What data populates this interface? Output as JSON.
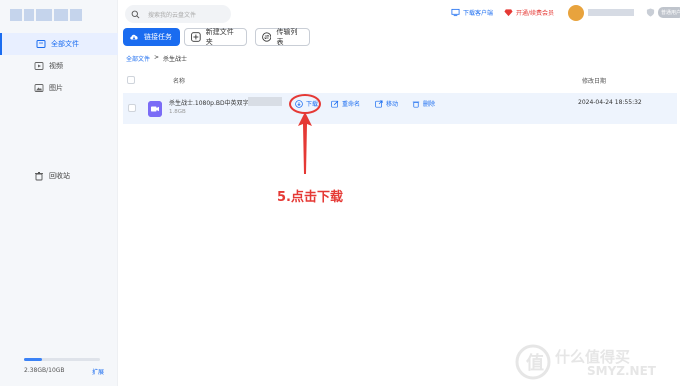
{
  "sidebar": {
    "items": [
      {
        "label": "全部文件",
        "icon": "folder-icon",
        "active": true
      },
      {
        "label": "视频",
        "icon": "video-icon"
      },
      {
        "label": "图片",
        "icon": "image-icon"
      },
      {
        "label": "回收站",
        "icon": "trash-icon"
      }
    ],
    "storage": {
      "text": "2.38GB/10GB",
      "expand": "扩展",
      "used_fraction": 0.238
    }
  },
  "header": {
    "search_placeholder": "搜索我的云盘文件",
    "client_link": "下载客户端",
    "vip_link": "开通/续费会员",
    "vip_badge": "普通用户"
  },
  "toolbar": {
    "link_task": "链接任务",
    "new_folder": "新建文件夹",
    "transfer_list": "传输列表"
  },
  "breadcrumb": {
    "root": "全部文件",
    "sep": ">",
    "current": "杀生战士"
  },
  "table": {
    "col_name": "名称",
    "col_date": "修改日期",
    "rows": [
      {
        "name": "杀生战士.1080p.BD中英双字",
        "size": "1.8GB",
        "date": "2024-04-24 18:55:32",
        "actions": [
          "下载",
          "重命名",
          "移动",
          "删除"
        ]
      }
    ]
  },
  "annotation": {
    "text": "5.点击下载",
    "color": "#e53935"
  },
  "watermark": {
    "cn": "什么值得买",
    "en": "SMYZ.NET"
  },
  "colors": {
    "accent": "#1a6cf0",
    "annotation": "#e53935",
    "file_icon": "#7b6cf6"
  }
}
